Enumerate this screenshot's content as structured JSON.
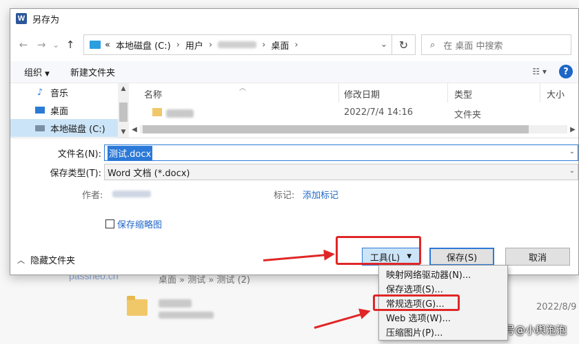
{
  "window": {
    "title": "另存为",
    "app_icon": "W"
  },
  "nav": {
    "back": "←",
    "forward": "→",
    "history": "⌄",
    "up": "↑"
  },
  "address": {
    "back_chevron": "«",
    "crumbs": [
      "本地磁盘 (C:)",
      "用户",
      "桌面"
    ],
    "refresh": "↻"
  },
  "search": {
    "placeholder": "在 桌面 中搜索"
  },
  "toolbar": {
    "organize": "组织",
    "new_folder": "新建文件夹",
    "help": "?"
  },
  "tree": {
    "items": [
      "音乐",
      "桌面",
      "本地磁盘 (C:)"
    ]
  },
  "columns": {
    "name": "名称",
    "date": "修改日期",
    "type": "类型",
    "size": "大小"
  },
  "files": [
    {
      "date": "2022/7/4 14:16",
      "type": "文件夹"
    }
  ],
  "form": {
    "filename_label": "文件名(N):",
    "filename_value": "测试.docx",
    "filetype_label": "保存类型(T):",
    "filetype_value": "Word 文档 (*.docx)",
    "author_label": "作者:",
    "tags_label": "标记:",
    "tags_link": "添加标记",
    "thumbnail_label": "保存缩略图"
  },
  "footer": {
    "hide_folders": "隐藏文件夹",
    "tools": "工具(L)",
    "save": "保存(S)",
    "cancel": "取消"
  },
  "tools_menu": {
    "items": [
      "映射网络驱动器(N)...",
      "保存选项(S)...",
      "常规选项(G)...",
      "Web 选项(W)...",
      "压缩图片(P)..."
    ]
  },
  "background": {
    "path": "桌面 » 测试 » 测试 (2)",
    "date": "2022/8/9",
    "watermark_left": "passneo.cn",
    "watermark_right": "搜狐号@小舆泡泡"
  },
  "colors": {
    "accent": "#2b79d8",
    "highlight_red": "#e02626"
  }
}
